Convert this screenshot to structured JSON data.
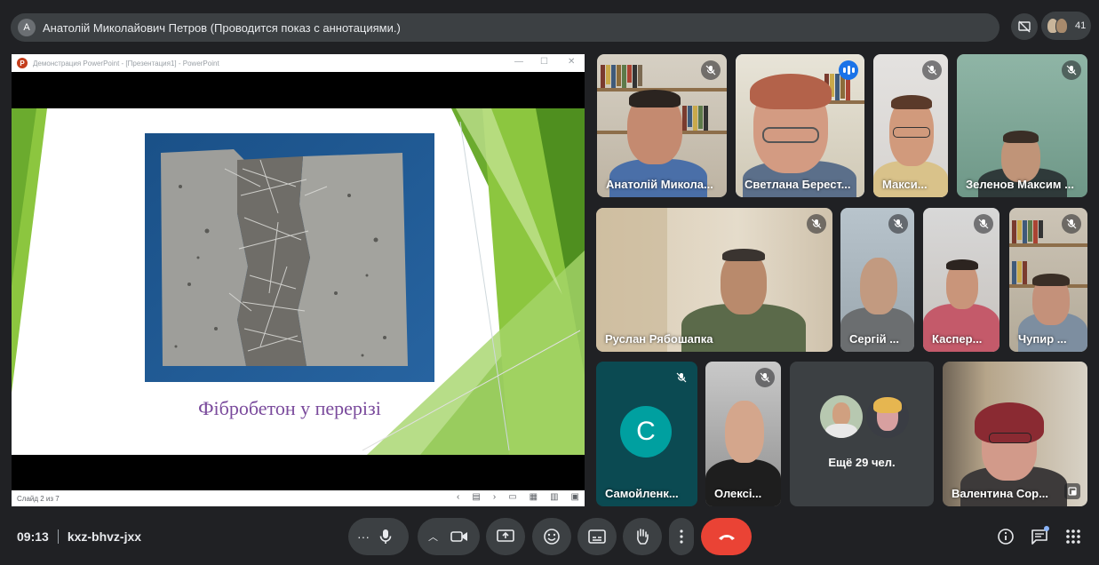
{
  "presenter_bar": {
    "avatar_letter": "А",
    "text": "Анатолій Миколайович Петров (Проводится показ с аннотациями.)"
  },
  "header": {
    "people_count": "41"
  },
  "presentation": {
    "window_title": "Демонстрация PowerPoint - [Презентация1] - PowerPoint",
    "app_logo": "P",
    "slide_caption": "Фібробетон у перерізі",
    "status": "Слайд 2 из 7"
  },
  "participants": [
    {
      "name": "Анатолій Микола...",
      "muted": true
    },
    {
      "name": "Светлана Берест...",
      "muted": false,
      "speaking": true
    },
    {
      "name": "Макси...",
      "muted": true
    },
    {
      "name": "Зеленов Максим ...",
      "muted": true
    },
    {
      "name": "Руслан Рябошапка",
      "muted": true
    },
    {
      "name": "Сергій ...",
      "muted": true
    },
    {
      "name": "Каспер...",
      "muted": true
    },
    {
      "name": "Чупир ...",
      "muted": true
    },
    {
      "name": "Самойленк...",
      "muted": true,
      "avatar_letter": "С"
    },
    {
      "name": "Олексі...",
      "muted": true
    },
    {
      "name": "Валентина Сор...",
      "muted": false
    }
  ],
  "more_tile": {
    "text": "Ещё 29 чел."
  },
  "bottom_bar": {
    "time": "09:13",
    "meeting_code": "kxz-bhvz-jxx"
  },
  "colors": {
    "background": "#202124",
    "surface": "#3c4043",
    "end_call": "#ea4335",
    "accent": "#8ab4f8",
    "slide_green": "#8cc63f"
  }
}
